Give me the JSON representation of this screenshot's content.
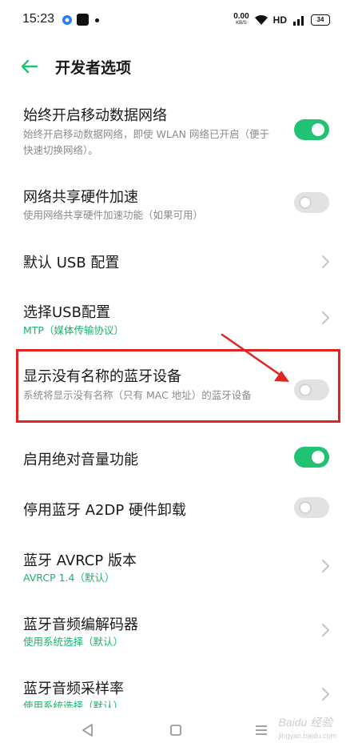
{
  "status_bar": {
    "time": "15:23",
    "net_speed_value": "0.00",
    "net_speed_unit": "KB/S",
    "hd_label": "HD",
    "battery": "34"
  },
  "header": {
    "title": "开发者选项"
  },
  "settings": [
    {
      "title": "始终开启移动数据网络",
      "summary": "始终开启移动数据网络，即使 WLAN 网络已开启（便于快速切换网络）。",
      "control": "switch",
      "state": "on"
    },
    {
      "title": "网络共享硬件加速",
      "summary": "使用网络共享硬件加速功能（如果可用）",
      "control": "switch",
      "state": "off"
    },
    {
      "title": "默认 USB 配置",
      "control": "chevron"
    },
    {
      "title": "选择USB配置",
      "summary": "MTP（媒体传输协议）",
      "control": "chevron"
    },
    {
      "title": "显示没有名称的蓝牙设备",
      "summary": "系统将显示没有名称（只有 MAC 地址）的蓝牙设备",
      "control": "switch",
      "state": "off",
      "highlighted": true
    },
    {
      "title": "启用绝对音量功能",
      "control": "switch",
      "state": "on"
    },
    {
      "title": "停用蓝牙 A2DP 硬件卸载",
      "control": "switch",
      "state": "off"
    },
    {
      "title": "蓝牙 AVRCP 版本",
      "summary": "AVRCP 1.4（默认）",
      "control": "chevron"
    },
    {
      "title": "蓝牙音频编解码器",
      "summary": "使用系统选择（默认）",
      "control": "chevron"
    },
    {
      "title": "蓝牙音频采样率",
      "summary": "使用系统选择（默认）",
      "control": "chevron"
    }
  ],
  "watermark": {
    "main": "Baidu 经验",
    "sub": "jingyan.baidu.com"
  },
  "colors": {
    "accent_green": "#21c274",
    "summary_green": "#19b36b",
    "highlight_red": "#e02424"
  },
  "icons": {
    "back": "arrow-left-icon",
    "nav_back": "triangle-back-icon",
    "nav_home": "square-home-icon",
    "nav_recent": "menu-lines-icon"
  }
}
